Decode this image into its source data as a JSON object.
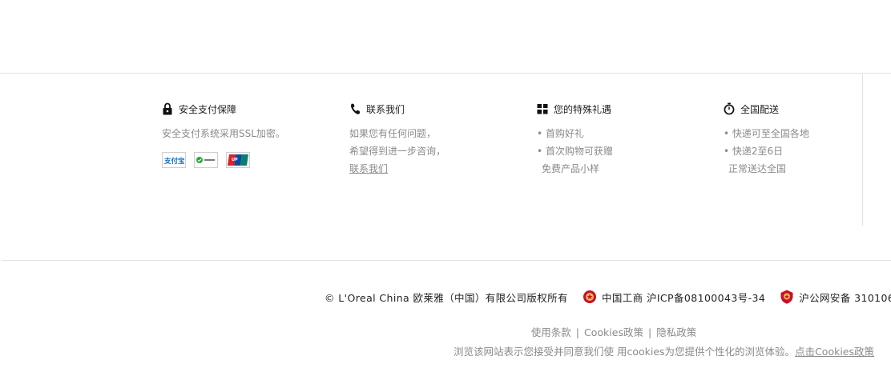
{
  "features": [
    {
      "icon": "lock-icon",
      "title": "安全支付保障",
      "lines": [
        "安全支付系统采用SSL加密。"
      ]
    },
    {
      "icon": "phone-icon",
      "title": "联系我们",
      "lines": [
        "如果您有任何问题，",
        "希望得到进一步咨询，"
      ],
      "link": "联系我们"
    },
    {
      "icon": "gift-icon",
      "title": "您的特殊礼遇",
      "lines": [
        "• 首购好礼",
        "• 首次购物可获赠",
        "免费产品小样"
      ]
    },
    {
      "icon": "stopwatch-icon",
      "title": "全国配送",
      "lines": [
        "• 快递可至全国各地",
        "• 快递2至6日",
        "正常送达全国"
      ]
    }
  ],
  "payment_logos": [
    "alipay-logo",
    "wechat-pay-logo",
    "unionpay-logo"
  ],
  "footer": {
    "copyright": "© L'Oreal China 欧莱雅（中国）有限公司版权所有",
    "icp": "中国工商 沪ICP备08100043号-34",
    "police": "沪公网安备 310106",
    "terms_use": "使用条款",
    "terms_cookies": "Cookies政策",
    "terms_privacy": "隐私政策",
    "cookie_notice": "浏览该网站表示您接受并同意我们使 用cookies为您提供个性化的浏览体验。",
    "cookie_link": "点击Cookies政策"
  },
  "colors": {
    "text": "#222222",
    "muted": "#8a8a8a",
    "divider": "#e2e2e2",
    "unionpay_red": "#d7222a",
    "wechat_green": "#22ac38",
    "alipay_blue": "#0a6fc2"
  }
}
